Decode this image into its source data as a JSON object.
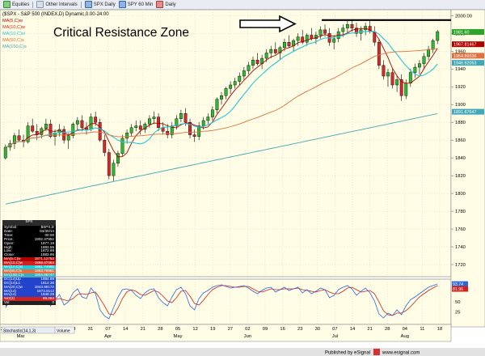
{
  "toolbar": {
    "items": [
      {
        "label": "Equities",
        "icon": "equities-icon"
      },
      {
        "label": "Other Intervals",
        "icon": "intervals-icon"
      },
      {
        "label": "SPX Daily",
        "icon": "chart-icon"
      },
      {
        "label": "SPY 60 Min",
        "icon": "chart-icon"
      },
      {
        "label": "Daily",
        "icon": "chart-icon"
      }
    ]
  },
  "chart_header": "($SPX - S&P 500 (INDEX,D) Dynamic,0.00-24:00",
  "legend": [
    {
      "label": "MA(5,C)w",
      "color": "#b00000"
    },
    {
      "label": "MA(10,C)w",
      "color": "#d02020"
    },
    {
      "label": "MA(10,C)si",
      "color": "#20c8d8"
    },
    {
      "label": "MA(50,C)s",
      "color": "#e07040"
    },
    {
      "label": "MA(150,C)s",
      "color": "#40a8b8"
    }
  ],
  "annotation": "Critical Resistance Zone",
  "price_axis": {
    "ticks": [
      "2000.00",
      "1980",
      "1960",
      "1940",
      "1920",
      "1900",
      "1880",
      "1860",
      "1840",
      "1820",
      "1800",
      "1780",
      "1760",
      "1740",
      "1720"
    ],
    "markers": [
      {
        "text": "1981.60",
        "color": "#2aa52a"
      },
      {
        "text": "1967.81467",
        "color": "#b00000"
      },
      {
        "text": "1954.89336",
        "color": "#e07040"
      },
      {
        "text": "1946.92053",
        "color": "#40a8b8"
      },
      {
        "text": "1891.87647",
        "color": "#40a8b8"
      }
    ]
  },
  "osc_axis": {
    "ticks": [
      "50",
      "25"
    ],
    "markers": [
      {
        "text": "93.74",
        "color": "#2a66d8"
      },
      {
        "text": "81.96",
        "color": "#d02020"
      }
    ]
  },
  "date_axis": {
    "days": [
      "24",
      "03",
      "10",
      "17",
      "24",
      "31",
      "07",
      "14",
      "21",
      "28",
      "05",
      "12",
      "19",
      "27",
      "02",
      "09",
      "16",
      "23",
      "30",
      "07",
      "14",
      "21",
      "28",
      "04",
      "11",
      "18"
    ],
    "months": [
      "Mar",
      "Apr",
      "May",
      "Jun",
      "Jul",
      "Aug"
    ]
  },
  "data_window": {
    "header": "SPX",
    "rows": [
      {
        "label": "Symbol",
        "value": "$SPX,D"
      },
      {
        "label": "Date",
        "value": "04/30/14"
      },
      {
        "label": "Time",
        "value": "00:00"
      },
      {
        "label": "Price",
        "value": "1902.37992"
      },
      {
        "label": "Open",
        "value": "1877.18"
      },
      {
        "label": "High",
        "value": "1883.55"
      },
      {
        "label": "Low",
        "value": "1872.69"
      },
      {
        "label": "Close",
        "value": "1883.95"
      }
    ],
    "indicators": [
      {
        "label": "MA(5,C)w",
        "value": "1871.12753",
        "bg": "#b00000"
      },
      {
        "label": "MA(10,C)w",
        "value": "1868.47064",
        "bg": "#d02020"
      },
      {
        "label": "MA(10,C)si",
        "value": "1861.74995",
        "bg": "#20c8d8"
      },
      {
        "label": "MA(50,C)s",
        "value": "1863.78961",
        "bg": "#e07040"
      },
      {
        "label": "MA(150,C)s",
        "value": "1804.96747",
        "bg": "#40a8b8"
      },
      {
        "label": "DC(14)Up",
        "value": "1884.89",
        "bg": "#2244cc"
      },
      {
        "label": "DC(14)Lo",
        "value": "1814.36",
        "bg": "#2244cc"
      },
      {
        "label": "MA(20,C)w",
        "value": "1843.98172",
        "bg": "#2244cc"
      },
      {
        "label": "MA(14)",
        "value": "1873.8112",
        "bg": "#2244cc"
      },
      {
        "label": "MA(14)",
        "value": "1848.28",
        "bg": "#2244cc"
      },
      {
        "label": "%D(3)",
        "value": "89.064",
        "bg": "#cc2222"
      },
      {
        "label": "Vol",
        "value": "0",
        "bg": "#222222"
      }
    ]
  },
  "study_tabs": [
    "Stochastic(14,1,3)",
    "Volume"
  ],
  "footer": {
    "published": "Published by eSignal",
    "url": "www.esignal.com"
  },
  "chart_data": {
    "type": "candlestick",
    "title": "",
    "resistance_level": 1995,
    "price_ylim": [
      1710,
      2003
    ],
    "osc_ylim": [
      0,
      100
    ],
    "candles": [
      [
        1840,
        1855,
        1838,
        1852
      ],
      [
        1852,
        1860,
        1848,
        1856
      ],
      [
        1856,
        1868,
        1850,
        1865
      ],
      [
        1865,
        1872,
        1858,
        1860
      ],
      [
        1860,
        1866,
        1852,
        1858
      ],
      [
        1858,
        1880,
        1856,
        1876
      ],
      [
        1876,
        1884,
        1868,
        1870
      ],
      [
        1870,
        1878,
        1860,
        1866
      ],
      [
        1866,
        1875,
        1862,
        1873
      ],
      [
        1873,
        1884,
        1870,
        1878
      ],
      [
        1878,
        1883,
        1862,
        1864
      ],
      [
        1864,
        1872,
        1854,
        1868
      ],
      [
        1868,
        1878,
        1864,
        1872
      ],
      [
        1872,
        1876,
        1856,
        1860
      ],
      [
        1860,
        1868,
        1850,
        1865
      ],
      [
        1865,
        1880,
        1862,
        1878
      ],
      [
        1878,
        1886,
        1872,
        1882
      ],
      [
        1882,
        1888,
        1870,
        1874
      ],
      [
        1874,
        1880,
        1866,
        1872
      ],
      [
        1872,
        1890,
        1870,
        1886
      ],
      [
        1886,
        1892,
        1876,
        1880
      ],
      [
        1880,
        1884,
        1858,
        1860
      ],
      [
        1860,
        1866,
        1842,
        1846
      ],
      [
        1846,
        1850,
        1816,
        1820
      ],
      [
        1820,
        1838,
        1814,
        1834
      ],
      [
        1834,
        1848,
        1830,
        1845
      ],
      [
        1845,
        1866,
        1842,
        1862
      ],
      [
        1862,
        1872,
        1856,
        1868
      ],
      [
        1868,
        1878,
        1864,
        1874
      ],
      [
        1874,
        1882,
        1870,
        1876
      ],
      [
        1876,
        1882,
        1866,
        1872
      ],
      [
        1872,
        1880,
        1868,
        1878
      ],
      [
        1878,
        1888,
        1874,
        1884
      ],
      [
        1884,
        1892,
        1878,
        1886
      ],
      [
        1886,
        1890,
        1870,
        1874
      ],
      [
        1874,
        1880,
        1866,
        1870
      ],
      [
        1870,
        1878,
        1862,
        1866
      ],
      [
        1866,
        1880,
        1862,
        1876
      ],
      [
        1876,
        1888,
        1872,
        1884
      ],
      [
        1884,
        1894,
        1880,
        1890
      ],
      [
        1890,
        1896,
        1876,
        1880
      ],
      [
        1880,
        1884,
        1862,
        1866
      ],
      [
        1866,
        1872,
        1858,
        1864
      ],
      [
        1864,
        1880,
        1860,
        1876
      ],
      [
        1876,
        1886,
        1872,
        1882
      ],
      [
        1882,
        1890,
        1878,
        1886
      ],
      [
        1886,
        1898,
        1882,
        1894
      ],
      [
        1894,
        1908,
        1890,
        1906
      ],
      [
        1906,
        1914,
        1900,
        1910
      ],
      [
        1910,
        1920,
        1906,
        1918
      ],
      [
        1918,
        1926,
        1912,
        1922
      ],
      [
        1922,
        1930,
        1918,
        1926
      ],
      [
        1926,
        1936,
        1922,
        1932
      ],
      [
        1932,
        1942,
        1928,
        1938
      ],
      [
        1938,
        1948,
        1934,
        1944
      ],
      [
        1944,
        1954,
        1940,
        1950
      ],
      [
        1950,
        1958,
        1944,
        1946
      ],
      [
        1946,
        1956,
        1940,
        1952
      ],
      [
        1952,
        1962,
        1948,
        1958
      ],
      [
        1958,
        1966,
        1952,
        1962
      ],
      [
        1962,
        1970,
        1956,
        1958
      ],
      [
        1958,
        1966,
        1950,
        1964
      ],
      [
        1964,
        1974,
        1960,
        1970
      ],
      [
        1970,
        1978,
        1964,
        1966
      ],
      [
        1966,
        1974,
        1960,
        1972
      ],
      [
        1972,
        1980,
        1966,
        1976
      ],
      [
        1976,
        1984,
        1968,
        1970
      ],
      [
        1970,
        1980,
        1966,
        1978
      ],
      [
        1978,
        1986,
        1972,
        1974
      ],
      [
        1974,
        1982,
        1968,
        1978
      ],
      [
        1978,
        1988,
        1974,
        1984
      ],
      [
        1984,
        1990,
        1976,
        1980
      ],
      [
        1980,
        1986,
        1966,
        1970
      ],
      [
        1970,
        1978,
        1962,
        1974
      ],
      [
        1974,
        1986,
        1970,
        1982
      ],
      [
        1982,
        1990,
        1976,
        1986
      ],
      [
        1986,
        1994,
        1980,
        1990
      ],
      [
        1990,
        1996,
        1982,
        1986
      ],
      [
        1986,
        1992,
        1976,
        1980
      ],
      [
        1980,
        1988,
        1972,
        1984
      ],
      [
        1984,
        1992,
        1978,
        1988
      ],
      [
        1988,
        1994,
        1980,
        1982
      ],
      [
        1982,
        1988,
        1966,
        1970
      ],
      [
        1970,
        1974,
        1940,
        1944
      ],
      [
        1944,
        1950,
        1928,
        1932
      ],
      [
        1932,
        1940,
        1920,
        1936
      ],
      [
        1936,
        1940,
        1918,
        1922
      ],
      [
        1922,
        1932,
        1914,
        1928
      ],
      [
        1928,
        1934,
        1904,
        1910
      ],
      [
        1910,
        1928,
        1906,
        1924
      ],
      [
        1924,
        1940,
        1920,
        1936
      ],
      [
        1936,
        1946,
        1930,
        1942
      ],
      [
        1942,
        1950,
        1934,
        1946
      ],
      [
        1946,
        1958,
        1940,
        1954
      ],
      [
        1954,
        1966,
        1950,
        1962
      ],
      [
        1962,
        1974,
        1958,
        1972
      ],
      [
        1972,
        1984,
        1968,
        1982
      ]
    ],
    "stochastic_k": [
      35,
      55,
      70,
      60,
      50,
      75,
      65,
      45,
      60,
      72,
      40,
      55,
      68,
      42,
      50,
      72,
      82,
      62,
      58,
      84,
      70,
      30,
      15,
      8,
      35,
      62,
      80,
      82,
      78,
      66,
      58,
      72,
      80,
      82,
      60,
      48,
      40,
      62,
      80,
      86,
      70,
      40,
      30,
      58,
      72,
      78,
      86,
      90,
      92,
      88,
      84,
      86,
      88,
      90,
      84,
      76,
      70,
      78,
      84,
      86,
      74,
      80,
      86,
      78,
      82,
      86,
      72,
      80,
      70,
      76,
      84,
      80,
      60,
      66,
      80,
      86,
      90,
      82,
      66,
      76,
      84,
      72,
      52,
      20,
      10,
      22,
      16,
      30,
      18,
      40,
      55,
      62,
      70,
      78,
      86,
      90,
      94
    ],
    "stochastic_d": [
      40,
      48,
      60,
      62,
      60,
      62,
      65,
      60,
      58,
      62,
      58,
      55,
      58,
      55,
      52,
      58,
      68,
      70,
      68,
      72,
      74,
      58,
      40,
      20,
      18,
      35,
      58,
      75,
      80,
      76,
      68,
      66,
      72,
      78,
      74,
      64,
      52,
      48,
      60,
      76,
      78,
      64,
      46,
      42,
      54,
      68,
      80,
      86,
      90,
      90,
      88,
      86,
      86,
      88,
      88,
      82,
      76,
      74,
      78,
      82,
      80,
      80,
      82,
      82,
      82,
      84,
      80,
      78,
      76,
      74,
      78,
      80,
      74,
      70,
      70,
      76,
      84,
      86,
      80,
      74,
      76,
      78,
      70,
      50,
      28,
      18,
      16,
      22,
      22,
      28,
      38,
      50,
      62,
      70,
      78,
      84,
      90
    ]
  }
}
